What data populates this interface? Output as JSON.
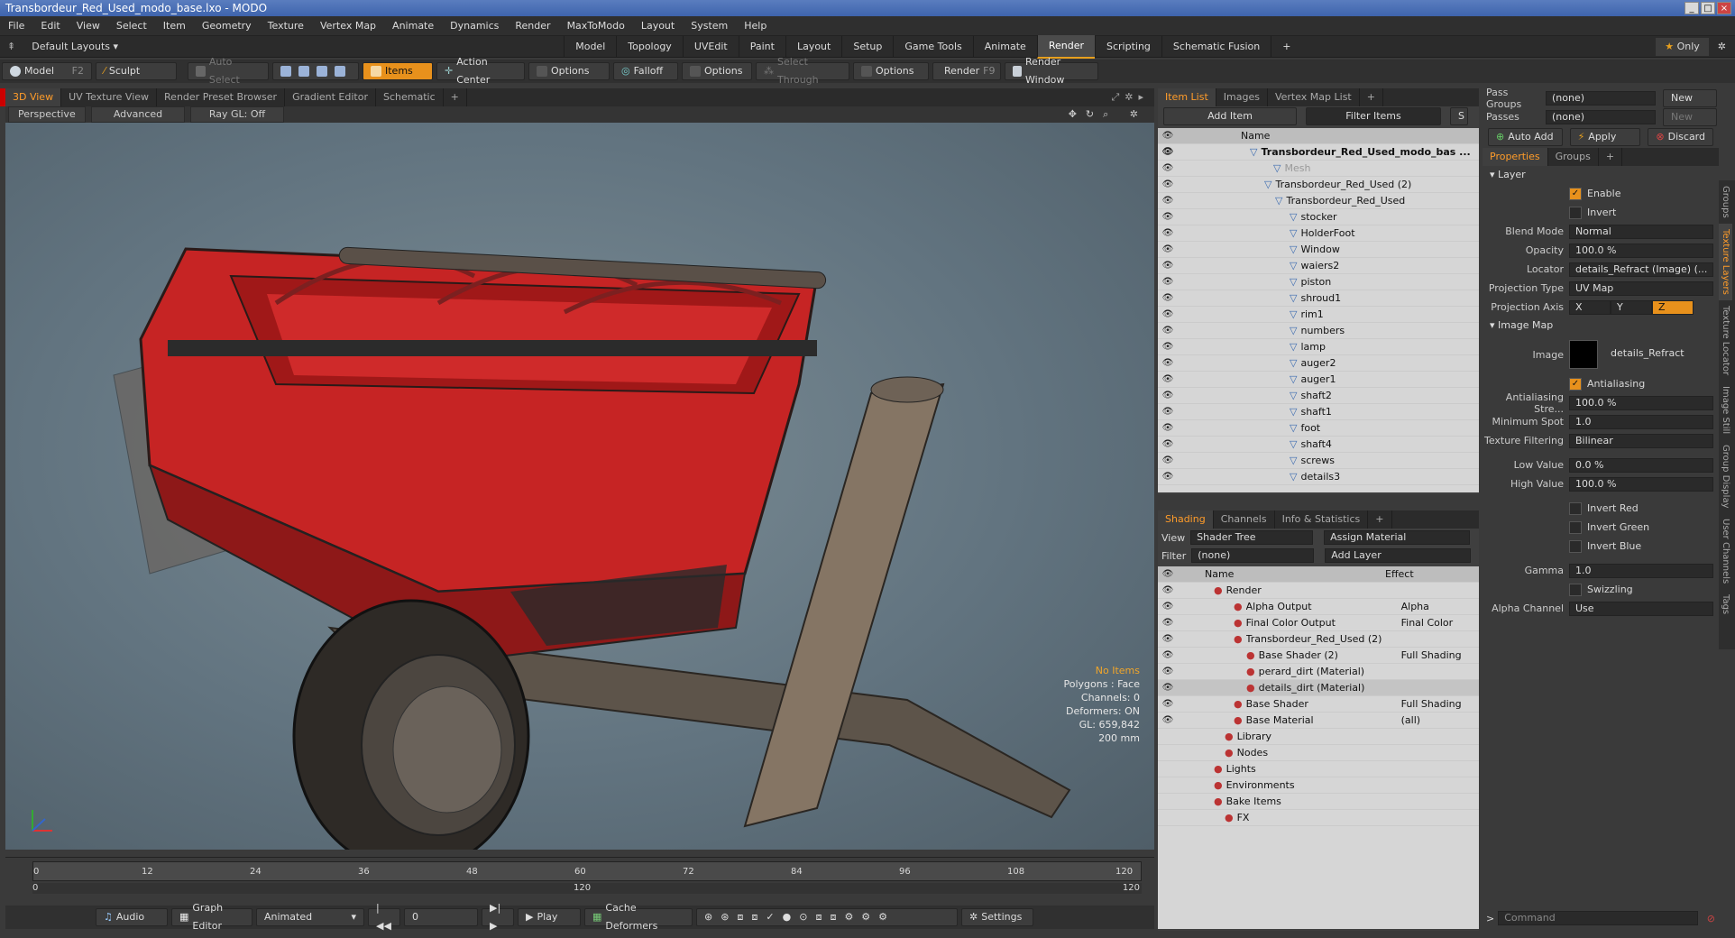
{
  "window": {
    "title": "Transbordeur_Red_Used_modo_base.lxo - MODO"
  },
  "menu": [
    "File",
    "Edit",
    "View",
    "Select",
    "Item",
    "Geometry",
    "Texture",
    "Vertex Map",
    "Animate",
    "Dynamics",
    "Render",
    "MaxToModo",
    "Layout",
    "System",
    "Help"
  ],
  "layout_bar": {
    "preset": "Default Layouts ▾",
    "tabs": [
      "Model",
      "Topology",
      "UVEdit",
      "Paint",
      "Layout",
      "Setup",
      "Game Tools",
      "Animate",
      "Render",
      "Scripting",
      "Schematic Fusion"
    ],
    "active": "Render",
    "only_label": "Only"
  },
  "toolbar": {
    "model": "Model",
    "model_key": "F2",
    "sculpt": "Sculpt",
    "auto_select": "Auto Select",
    "items": "Items",
    "action_center": "Action Center",
    "options1": "Options",
    "falloff": "Falloff",
    "options2": "Options",
    "select_through": "Select Through",
    "options3": "Options",
    "render": "Render",
    "render_key": "F9",
    "render_window": "Render Window"
  },
  "viewport": {
    "tabs": [
      "3D View",
      "UV Texture View",
      "Render Preset Browser",
      "Gradient Editor",
      "Schematic"
    ],
    "active": "3D View",
    "mode": "Perspective",
    "shading": "Advanced",
    "raygl": "Ray GL: Off",
    "info": {
      "no_items": "No Items",
      "polygons": "Polygons : Face",
      "channels": "Channels: 0",
      "deformers": "Deformers: ON",
      "gl": "GL: 659,842",
      "size": "200 mm"
    }
  },
  "timeline": {
    "ticks": [
      "0",
      "12",
      "24",
      "36",
      "48",
      "60",
      "72",
      "84",
      "96",
      "108",
      "120"
    ],
    "start": "0",
    "end": "120",
    "end2": "120"
  },
  "transport": {
    "audio": "Audio",
    "graph_editor": "Graph Editor",
    "animated": "Animated",
    "frame": "0",
    "play": "Play",
    "cache": "Cache Deformers",
    "settings": "Settings"
  },
  "item_list": {
    "tabs": [
      "Item List",
      "Images",
      "Vertex Map List"
    ],
    "active": "Item List",
    "add_item": "Add Item",
    "filter": "Filter Items",
    "col_name": "Name",
    "rows": [
      {
        "label": "Transbordeur_Red_Used_modo_bas ...",
        "indent": 80,
        "style": "bold"
      },
      {
        "label": "Mesh",
        "indent": 106,
        "style": "grey"
      },
      {
        "label": "Transbordeur_Red_Used (2)",
        "indent": 96,
        "style": ""
      },
      {
        "label": "Transbordeur_Red_Used",
        "indent": 108,
        "style": ""
      },
      {
        "label": "stocker",
        "indent": 124,
        "style": ""
      },
      {
        "label": "HolderFoot",
        "indent": 124,
        "style": ""
      },
      {
        "label": "Window",
        "indent": 124,
        "style": ""
      },
      {
        "label": "waiers2",
        "indent": 124,
        "style": ""
      },
      {
        "label": "piston",
        "indent": 124,
        "style": ""
      },
      {
        "label": "shroud1",
        "indent": 124,
        "style": ""
      },
      {
        "label": "rim1",
        "indent": 124,
        "style": ""
      },
      {
        "label": "numbers",
        "indent": 124,
        "style": ""
      },
      {
        "label": "lamp",
        "indent": 124,
        "style": ""
      },
      {
        "label": "auger2",
        "indent": 124,
        "style": ""
      },
      {
        "label": "auger1",
        "indent": 124,
        "style": ""
      },
      {
        "label": "shaft2",
        "indent": 124,
        "style": ""
      },
      {
        "label": "shaft1",
        "indent": 124,
        "style": ""
      },
      {
        "label": "foot",
        "indent": 124,
        "style": ""
      },
      {
        "label": "shaft4",
        "indent": 124,
        "style": ""
      },
      {
        "label": "screws",
        "indent": 124,
        "style": ""
      },
      {
        "label": "details3",
        "indent": 124,
        "style": ""
      }
    ]
  },
  "shading": {
    "tabs": [
      "Shading",
      "Channels",
      "Info & Statistics"
    ],
    "active": "Shading",
    "view_label": "View",
    "view_val": "Shader Tree",
    "assign": "Assign Material",
    "filter_label": "Filter",
    "filter_val": "(none)",
    "add_layer": "Add Layer",
    "col_name": "Name",
    "col_effect": "Effect",
    "rows": [
      {
        "label": "Render",
        "effect": "",
        "indent": 40,
        "style": ""
      },
      {
        "label": "Alpha Output",
        "effect": "Alpha",
        "indent": 62,
        "style": ""
      },
      {
        "label": "Final Color Output",
        "effect": "Final Color",
        "indent": 62,
        "style": ""
      },
      {
        "label": "Transbordeur_Red_Used (2)",
        "effect": "",
        "indent": 62,
        "style": ""
      },
      {
        "label": "Base Shader (2)",
        "effect": "Full Shading",
        "indent": 76,
        "style": ""
      },
      {
        "label": "perard_dirt (Material)",
        "effect": "",
        "indent": 76,
        "style": ""
      },
      {
        "label": "details_dirt (Material)",
        "effect": "",
        "indent": 76,
        "style": "sel"
      },
      {
        "label": "Base Shader",
        "effect": "Full Shading",
        "indent": 62,
        "style": ""
      },
      {
        "label": "Base Material",
        "effect": "(all)",
        "indent": 62,
        "style": ""
      },
      {
        "label": "Library",
        "effect": "",
        "indent": 52,
        "style": ""
      },
      {
        "label": "Nodes",
        "effect": "",
        "indent": 52,
        "style": ""
      },
      {
        "label": "Lights",
        "effect": "",
        "indent": 40,
        "style": ""
      },
      {
        "label": "Environments",
        "effect": "",
        "indent": 40,
        "style": ""
      },
      {
        "label": "Bake Items",
        "effect": "",
        "indent": 40,
        "style": ""
      },
      {
        "label": "FX",
        "effect": "",
        "indent": 52,
        "style": ""
      }
    ]
  },
  "properties": {
    "pass_groups": "Pass Groups",
    "pass_groups_val": "(none)",
    "new1": "New",
    "passes": "Passes",
    "passes_val": "(none)",
    "new2": "New",
    "auto_add": "Auto Add",
    "apply": "Apply",
    "discard": "Discard",
    "tabs": [
      "Properties",
      "Groups"
    ],
    "active": "Properties",
    "layer": "Layer",
    "enable": "Enable",
    "invert": "Invert",
    "blend_mode": "Blend Mode",
    "blend_val": "Normal",
    "opacity": "Opacity",
    "opacity_val": "100.0 %",
    "locator": "Locator",
    "locator_val": "details_Refract (Image) (...",
    "proj_type": "Projection Type",
    "proj_type_val": "UV Map",
    "proj_axis": "Projection Axis",
    "x": "X",
    "y": "Y",
    "z": "Z",
    "image_map": "Image Map",
    "image": "Image",
    "image_val": "details_Refract",
    "antialiasing": "Antialiasing",
    "aa_strength": "Antialiasing Stre...",
    "aa_strength_val": "100.0 %",
    "min_spot": "Minimum Spot",
    "min_spot_val": "1.0",
    "tex_filter": "Texture Filtering",
    "tex_filter_val": "Bilinear",
    "low": "Low Value",
    "low_val": "0.0 %",
    "high": "High Value",
    "high_val": "100.0 %",
    "inv_red": "Invert Red",
    "inv_green": "Invert Green",
    "inv_blue": "Invert Blue",
    "gamma": "Gamma",
    "gamma_val": "1.0",
    "swizzling": "Swizzling",
    "alpha_ch": "Alpha Channel",
    "alpha_ch_val": "Use",
    "command": "Command"
  },
  "side_tabs": [
    "Groups",
    "Texture Layers",
    "Texture Locator",
    "Image Still",
    "Group Display",
    "User Channels",
    "Tags"
  ]
}
